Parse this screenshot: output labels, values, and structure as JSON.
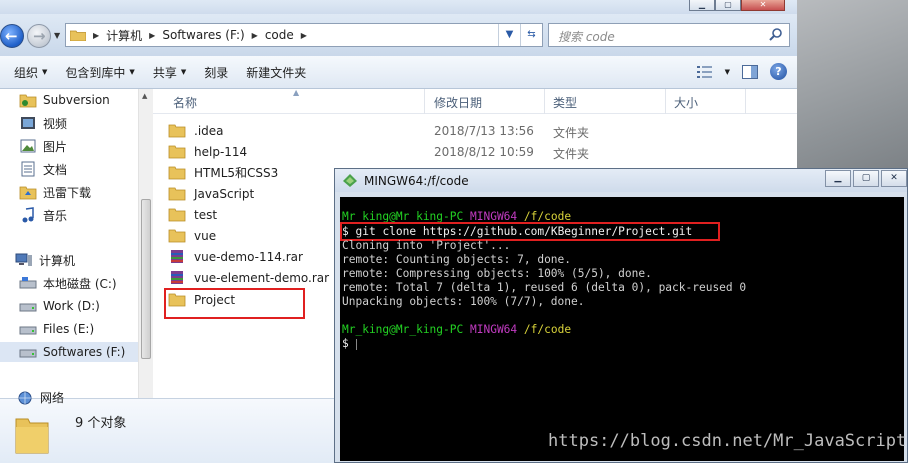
{
  "navbar": {
    "breadcrumbs": [
      "计算机",
      "Softwares (F:)",
      "code"
    ],
    "search_placeholder": "搜索 code"
  },
  "toolbar": {
    "items": [
      "组织",
      "包含到库中",
      "共享",
      "刻录",
      "新建文件夹"
    ]
  },
  "sidebar": {
    "items": [
      "Subversion",
      "视频",
      "图片",
      "文档",
      "迅雷下载",
      "音乐",
      "计算机",
      "本地磁盘 (C:)",
      "Work (D:)",
      "Files (E:)",
      "Softwares (F:)",
      "网络"
    ]
  },
  "filelist": {
    "columns": [
      "名称",
      "修改日期",
      "类型",
      "大小"
    ],
    "rows": [
      {
        "name": ".idea",
        "date": "2018/7/13 13:56",
        "type": "文件夹",
        "icon": "folder-icon"
      },
      {
        "name": "help-114",
        "date": "2018/8/12 10:59",
        "type": "文件夹",
        "icon": "folder-icon"
      },
      {
        "name": "HTML5和CSS3",
        "date": "",
        "type": "",
        "icon": "folder-icon"
      },
      {
        "name": "JavaScript",
        "date": "",
        "type": "",
        "icon": "folder-icon"
      },
      {
        "name": "test",
        "date": "",
        "type": "",
        "icon": "folder-icon"
      },
      {
        "name": "vue",
        "date": "",
        "type": "",
        "icon": "folder-icon"
      },
      {
        "name": "vue-demo-114.rar",
        "date": "",
        "type": "",
        "icon": "rar-archive-icon"
      },
      {
        "name": "vue-element-demo.rar",
        "date": "",
        "type": "",
        "icon": "rar-archive-icon"
      },
      {
        "name": "Project",
        "date": "",
        "type": "",
        "icon": "folder-icon"
      }
    ]
  },
  "details": {
    "count": "9 个对象"
  },
  "terminal": {
    "title": "MINGW64:/f/code",
    "prompt_user": "Mr_king@Mr_king-PC",
    "prompt_env": "MINGW64",
    "prompt_path": "/f/code",
    "command": "git clone https://github.com/KBeginner/Project.git",
    "output": [
      "Cloning into 'Project'...",
      "remote: Counting objects: 7, done.",
      "remote: Compressing objects: 100% (5/5), done.",
      "remote: Total 7 (delta 1), reused 6 (delta 0), pack-reused 0",
      "Unpacking objects: 100% (7/7), done."
    ],
    "dollar": "$"
  },
  "watermark": "https://blog.csdn.net/Mr_JavaScript",
  "colors": {
    "prompt_user": "#23d123",
    "prompt_env": "#c13bc1",
    "prompt_path": "#d8d23a",
    "highlight": "#e02020"
  }
}
